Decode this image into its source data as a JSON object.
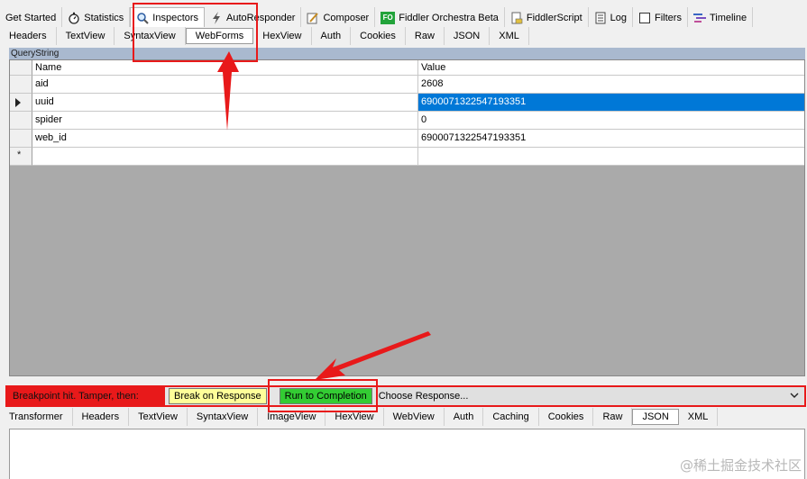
{
  "main_tabs": [
    {
      "label": "Get Started",
      "icon": "none"
    },
    {
      "label": "Statistics",
      "icon": "stopwatch-icon"
    },
    {
      "label": "Inspectors",
      "icon": "magnifier-icon",
      "active": true
    },
    {
      "label": "AutoResponder",
      "icon": "lightning-icon"
    },
    {
      "label": "Composer",
      "icon": "pencil-icon"
    },
    {
      "label": "Fiddler Orchestra Beta",
      "icon": "fo-badge-icon",
      "badge": "FO"
    },
    {
      "label": "FiddlerScript",
      "icon": "script-icon"
    },
    {
      "label": "Log",
      "icon": "log-icon"
    },
    {
      "label": "Filters",
      "icon": "checkbox-icon"
    },
    {
      "label": "Timeline",
      "icon": "timeline-icon"
    }
  ],
  "request_tabs": [
    "Headers",
    "TextView",
    "SyntaxView",
    "WebForms",
    "HexView",
    "Auth",
    "Cookies",
    "Raw",
    "JSON",
    "XML"
  ],
  "request_active": "WebForms",
  "querystring": {
    "title": "QueryString",
    "columns": [
      "Name",
      "Value"
    ],
    "rows": [
      {
        "name": "aid",
        "value": "2608"
      },
      {
        "name": "uuid",
        "value": "6900071322547193351"
      },
      {
        "name": "spider",
        "value": "0"
      },
      {
        "name": "web_id",
        "value": "6900071322547193351"
      }
    ],
    "new_row_marker": "*"
  },
  "breakpoint": {
    "label": "Breakpoint hit. Tamper, then:",
    "break_on_response": "Break on Response",
    "run_to_completion": "Run to Completion",
    "choose_response": "Choose Response..."
  },
  "response_tabs": [
    "Transformer",
    "Headers",
    "TextView",
    "SyntaxView",
    "ImageView",
    "HexView",
    "WebView",
    "Auth",
    "Caching",
    "Cookies",
    "Raw",
    "JSON",
    "XML"
  ],
  "response_active": "JSON",
  "watermark": "@稀土掘金技术社区",
  "colors": {
    "selection": "#0078d7",
    "callout": "#e8191a",
    "break_button": "#ffff99",
    "run_button": "#33cc33",
    "section_header": "#a9b9cf"
  }
}
